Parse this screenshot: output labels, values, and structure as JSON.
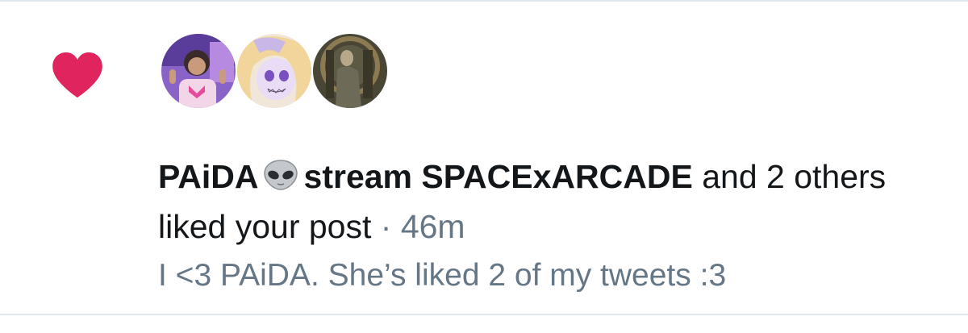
{
  "notification": {
    "type_icon": "heart-icon",
    "accent_color": "#e0245e",
    "avatars": [
      {
        "icon": "avatar-photo-person"
      },
      {
        "icon": "avatar-anime-character"
      },
      {
        "icon": "avatar-painting-figure"
      }
    ],
    "user_1_name": "PAiDA",
    "user_1_emoji": "alien-icon",
    "user_2_name": "stream SPACExARCADE",
    "connector": "and 2 others liked your post",
    "separator": "·",
    "timestamp": "46m",
    "post_preview": "I <3 PAiDA. She’s liked 2 of my tweets :3"
  }
}
